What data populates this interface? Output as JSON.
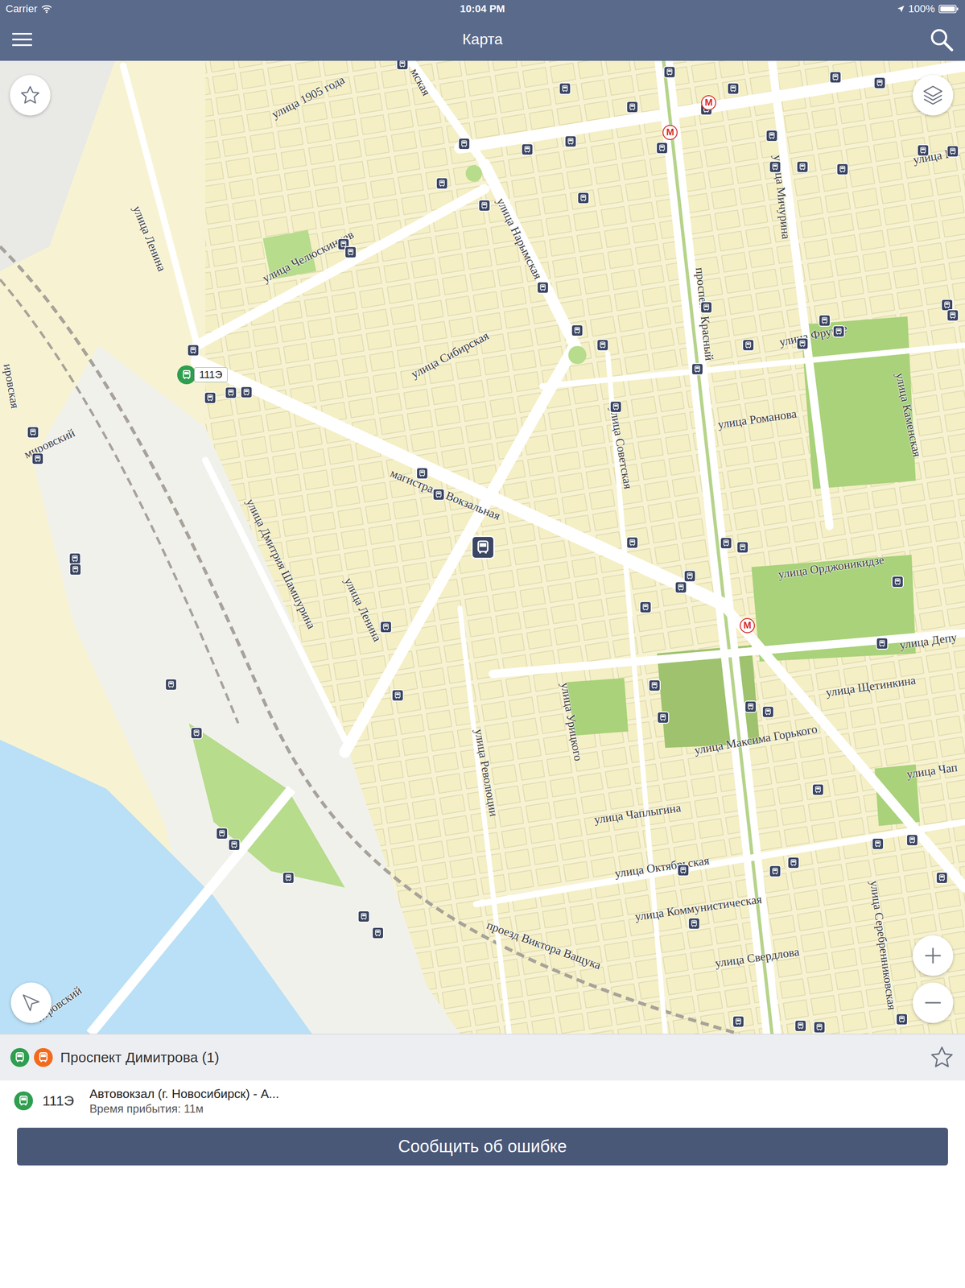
{
  "status_bar": {
    "carrier": "Carrier",
    "time": "10:04 PM",
    "battery": "100%"
  },
  "navbar": {
    "title": "Карта"
  },
  "map": {
    "labels": [
      "улица 1905 года",
      "мская",
      "улица Ленина",
      "улица Челюскинцев",
      "улица Нарымская",
      "улица Сибирская",
      "проспект Красный",
      "улица Мичурина",
      "улица Фрунзе",
      "улица Каменская",
      "улица Романова",
      "улица Советская",
      "магистраль Вокзальная",
      "улица Дмитрия Шамшурина",
      "улица Ленина",
      "улица Орджоникидзе",
      "улица Депу",
      "улица Щетинкина",
      "улица Максима Горького",
      "улица Урицкого",
      "улица Революции",
      "улица Чаплыгина",
      "улица Чап",
      "улица Октябрьская",
      "улица Коммунистическая",
      "улица Свердлова",
      "проезд Виктора Ващука",
      "улица Серебренниковская",
      "улица Ип",
      "ировская",
      "мировский",
      "итровский"
    ],
    "metro": [
      {
        "label": "М"
      },
      {
        "label": "М"
      },
      {
        "label": "М"
      }
    ],
    "vehicle": {
      "route": "111Э",
      "color": "#2e9e4f"
    }
  },
  "stop": {
    "name": "Проспект Димитрова (1)",
    "favorite": false,
    "transport": [
      {
        "kind": "bus",
        "color": "#2e9e4f"
      },
      {
        "kind": "trolleybus",
        "color": "#f26b1d"
      }
    ],
    "routes": [
      {
        "number": "111Э",
        "destination": "Автовокзал (г. Новосибирск) - А...",
        "arrival": "Время прибытия: 11м",
        "color": "#2e9e4f"
      }
    ]
  },
  "buttons": [
    "Сообщить об ошибке"
  ]
}
